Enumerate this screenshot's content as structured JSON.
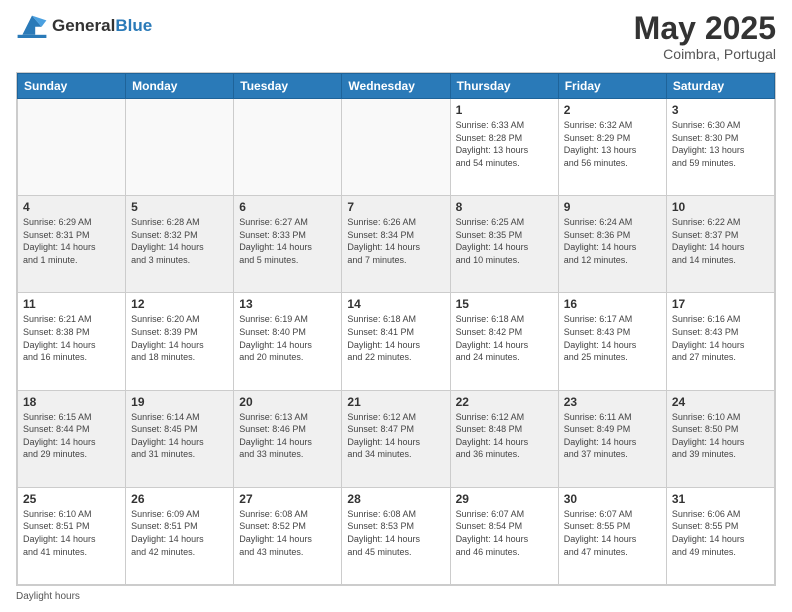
{
  "header": {
    "logo_general": "General",
    "logo_blue": "Blue",
    "title": "May 2025",
    "location": "Coimbra, Portugal"
  },
  "days_of_week": [
    "Sunday",
    "Monday",
    "Tuesday",
    "Wednesday",
    "Thursday",
    "Friday",
    "Saturday"
  ],
  "weeks": [
    [
      {
        "day": "",
        "info": "",
        "empty": true
      },
      {
        "day": "",
        "info": "",
        "empty": true
      },
      {
        "day": "",
        "info": "",
        "empty": true
      },
      {
        "day": "",
        "info": "",
        "empty": true
      },
      {
        "day": "1",
        "info": "Sunrise: 6:33 AM\nSunset: 8:28 PM\nDaylight: 13 hours\nand 54 minutes."
      },
      {
        "day": "2",
        "info": "Sunrise: 6:32 AM\nSunset: 8:29 PM\nDaylight: 13 hours\nand 56 minutes."
      },
      {
        "day": "3",
        "info": "Sunrise: 6:30 AM\nSunset: 8:30 PM\nDaylight: 13 hours\nand 59 minutes."
      }
    ],
    [
      {
        "day": "4",
        "info": "Sunrise: 6:29 AM\nSunset: 8:31 PM\nDaylight: 14 hours\nand 1 minute."
      },
      {
        "day": "5",
        "info": "Sunrise: 6:28 AM\nSunset: 8:32 PM\nDaylight: 14 hours\nand 3 minutes."
      },
      {
        "day": "6",
        "info": "Sunrise: 6:27 AM\nSunset: 8:33 PM\nDaylight: 14 hours\nand 5 minutes."
      },
      {
        "day": "7",
        "info": "Sunrise: 6:26 AM\nSunset: 8:34 PM\nDaylight: 14 hours\nand 7 minutes."
      },
      {
        "day": "8",
        "info": "Sunrise: 6:25 AM\nSunset: 8:35 PM\nDaylight: 14 hours\nand 10 minutes."
      },
      {
        "day": "9",
        "info": "Sunrise: 6:24 AM\nSunset: 8:36 PM\nDaylight: 14 hours\nand 12 minutes."
      },
      {
        "day": "10",
        "info": "Sunrise: 6:22 AM\nSunset: 8:37 PM\nDaylight: 14 hours\nand 14 minutes."
      }
    ],
    [
      {
        "day": "11",
        "info": "Sunrise: 6:21 AM\nSunset: 8:38 PM\nDaylight: 14 hours\nand 16 minutes."
      },
      {
        "day": "12",
        "info": "Sunrise: 6:20 AM\nSunset: 8:39 PM\nDaylight: 14 hours\nand 18 minutes."
      },
      {
        "day": "13",
        "info": "Sunrise: 6:19 AM\nSunset: 8:40 PM\nDaylight: 14 hours\nand 20 minutes."
      },
      {
        "day": "14",
        "info": "Sunrise: 6:18 AM\nSunset: 8:41 PM\nDaylight: 14 hours\nand 22 minutes."
      },
      {
        "day": "15",
        "info": "Sunrise: 6:18 AM\nSunset: 8:42 PM\nDaylight: 14 hours\nand 24 minutes."
      },
      {
        "day": "16",
        "info": "Sunrise: 6:17 AM\nSunset: 8:43 PM\nDaylight: 14 hours\nand 25 minutes."
      },
      {
        "day": "17",
        "info": "Sunrise: 6:16 AM\nSunset: 8:43 PM\nDaylight: 14 hours\nand 27 minutes."
      }
    ],
    [
      {
        "day": "18",
        "info": "Sunrise: 6:15 AM\nSunset: 8:44 PM\nDaylight: 14 hours\nand 29 minutes."
      },
      {
        "day": "19",
        "info": "Sunrise: 6:14 AM\nSunset: 8:45 PM\nDaylight: 14 hours\nand 31 minutes."
      },
      {
        "day": "20",
        "info": "Sunrise: 6:13 AM\nSunset: 8:46 PM\nDaylight: 14 hours\nand 33 minutes."
      },
      {
        "day": "21",
        "info": "Sunrise: 6:12 AM\nSunset: 8:47 PM\nDaylight: 14 hours\nand 34 minutes."
      },
      {
        "day": "22",
        "info": "Sunrise: 6:12 AM\nSunset: 8:48 PM\nDaylight: 14 hours\nand 36 minutes."
      },
      {
        "day": "23",
        "info": "Sunrise: 6:11 AM\nSunset: 8:49 PM\nDaylight: 14 hours\nand 37 minutes."
      },
      {
        "day": "24",
        "info": "Sunrise: 6:10 AM\nSunset: 8:50 PM\nDaylight: 14 hours\nand 39 minutes."
      }
    ],
    [
      {
        "day": "25",
        "info": "Sunrise: 6:10 AM\nSunset: 8:51 PM\nDaylight: 14 hours\nand 41 minutes."
      },
      {
        "day": "26",
        "info": "Sunrise: 6:09 AM\nSunset: 8:51 PM\nDaylight: 14 hours\nand 42 minutes."
      },
      {
        "day": "27",
        "info": "Sunrise: 6:08 AM\nSunset: 8:52 PM\nDaylight: 14 hours\nand 43 minutes."
      },
      {
        "day": "28",
        "info": "Sunrise: 6:08 AM\nSunset: 8:53 PM\nDaylight: 14 hours\nand 45 minutes."
      },
      {
        "day": "29",
        "info": "Sunrise: 6:07 AM\nSunset: 8:54 PM\nDaylight: 14 hours\nand 46 minutes."
      },
      {
        "day": "30",
        "info": "Sunrise: 6:07 AM\nSunset: 8:55 PM\nDaylight: 14 hours\nand 47 minutes."
      },
      {
        "day": "31",
        "info": "Sunrise: 6:06 AM\nSunset: 8:55 PM\nDaylight: 14 hours\nand 49 minutes."
      }
    ]
  ],
  "footer": {
    "note": "Daylight hours"
  },
  "colors": {
    "header_bg": "#2a7ab8",
    "header_text": "#ffffff",
    "cell_border": "#cccccc",
    "shaded_row": "#f0f0f0"
  }
}
